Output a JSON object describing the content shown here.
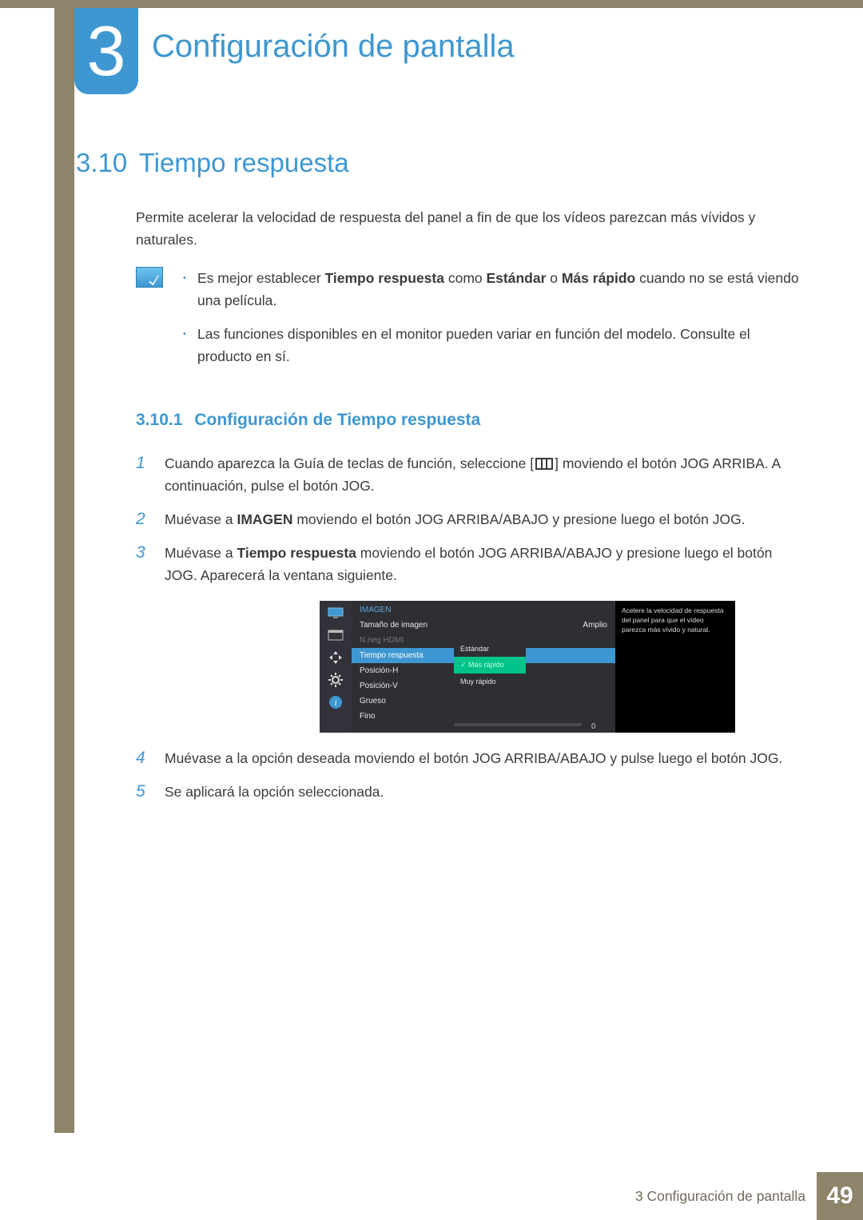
{
  "chapter": {
    "number": "3",
    "title": "Configuración de pantalla"
  },
  "section": {
    "number": "3.10",
    "title": "Tiempo respuesta",
    "intro": "Permite acelerar la velocidad de respuesta del panel a fin de que los vídeos parezcan más vívidos y naturales."
  },
  "notes": {
    "n1_pre": "Es mejor establecer ",
    "n1_b1": "Tiempo respuesta",
    "n1_mid1": " como ",
    "n1_b2": "Estándar",
    "n1_mid2": " o ",
    "n1_b3": "Más rápido",
    "n1_post": " cuando no se está viendo una película.",
    "n2": "Las funciones disponibles en el monitor pueden variar en función del modelo. Consulte el producto en sí."
  },
  "subsection": {
    "number": "3.10.1",
    "title": "Configuración de Tiempo respuesta"
  },
  "steps": {
    "s1a": "Cuando aparezca la Guía de teclas de función, seleccione [",
    "s1b": "] moviendo el botón JOG ARRIBA. A continuación, pulse el botón JOG.",
    "s2_pre": "Muévase a ",
    "s2_b": "IMAGEN",
    "s2_post": " moviendo el botón JOG ARRIBA/ABAJO y presione luego el botón JOG.",
    "s3_pre": "Muévase a ",
    "s3_b": "Tiempo respuesta",
    "s3_post": " moviendo el botón JOG ARRIBA/ABAJO y presione luego el botón JOG. Aparecerá la ventana siguiente.",
    "s4": "Muévase a la opción deseada moviendo el botón JOG ARRIBA/ABAJO y pulse luego el botón JOG.",
    "s5": "Se aplicará la opción seleccionada."
  },
  "step_numbers": {
    "n1": "1",
    "n2": "2",
    "n3": "3",
    "n4": "4",
    "n5": "5"
  },
  "osd": {
    "header": "IMAGEN",
    "rows": {
      "r1": "Tamaño de imagen",
      "r1v": "Amplio",
      "r2": "N.neg HDMI",
      "r3": "Tiempo respuesta",
      "r4": "Posición-H",
      "r5": "Posición-V",
      "r6": "Grueso",
      "r7": "Fino"
    },
    "dropdown": {
      "d1": "Estándar",
      "d2": "Más rápido",
      "d3": "Muy rápido"
    },
    "slider_value": "0",
    "help": "Acelere la velocidad de respuesta del panel para que el vídeo parezca más vívido y natural."
  },
  "footer": {
    "text": "3 Configuración de pantalla",
    "page": "49"
  }
}
